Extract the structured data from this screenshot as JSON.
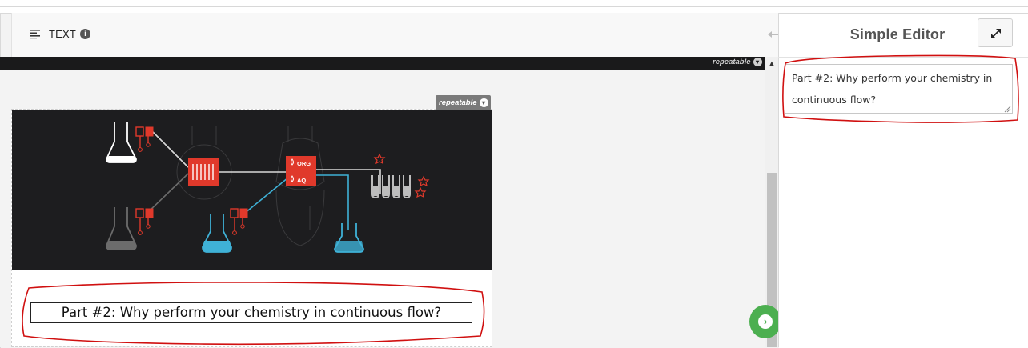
{
  "toolbar": {
    "label": "TEXT",
    "info_glyph": "i",
    "icon": "text-align-icon"
  },
  "canvas": {
    "repeatable_top": "repeatable",
    "repeatable_block": "repeatable",
    "headline": "Part #2: Why perform your chemistry in continuous flow?",
    "hero_labels": {
      "org": "ORG",
      "aq": "AQ"
    }
  },
  "editor": {
    "title": "Simple Editor",
    "textarea_value": "Part #2: Why perform your chemistry in continuous flow?"
  },
  "colors": {
    "accent_red": "#e0392b",
    "accent_blue": "#3fb1d6",
    "fab_green": "#4caf50",
    "hero_bg": "#1d1d1f",
    "annotation_red": "#d01010"
  }
}
